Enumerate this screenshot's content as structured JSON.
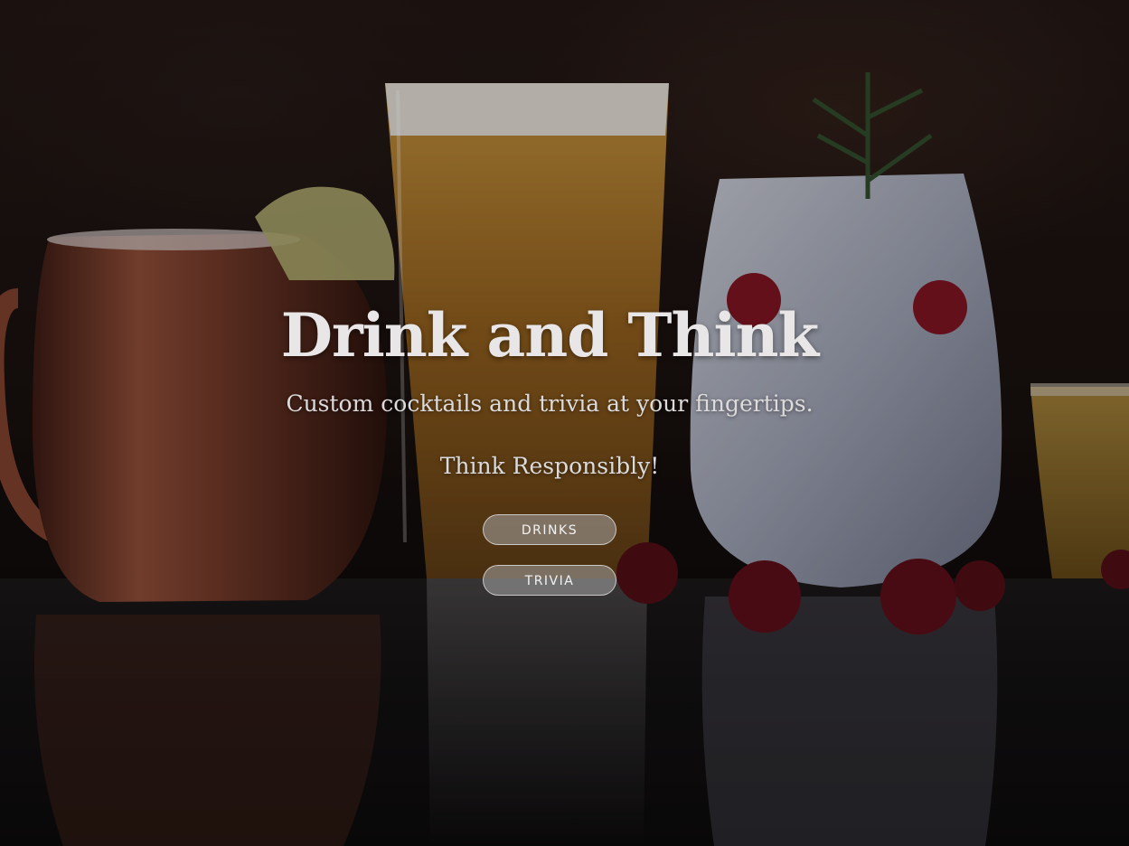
{
  "hero": {
    "title": "Drink and Think",
    "subtitle": "Custom cocktails and trivia at your fingertips.",
    "tagline": "Think Responsibly!"
  },
  "buttons": {
    "drinks_label": "DRINKS",
    "trivia_label": "TRIVIA"
  },
  "colors": {
    "title_text": "#e8e6e6",
    "button_bg": "#a5a5a5",
    "background_dark": "#0b0707"
  }
}
